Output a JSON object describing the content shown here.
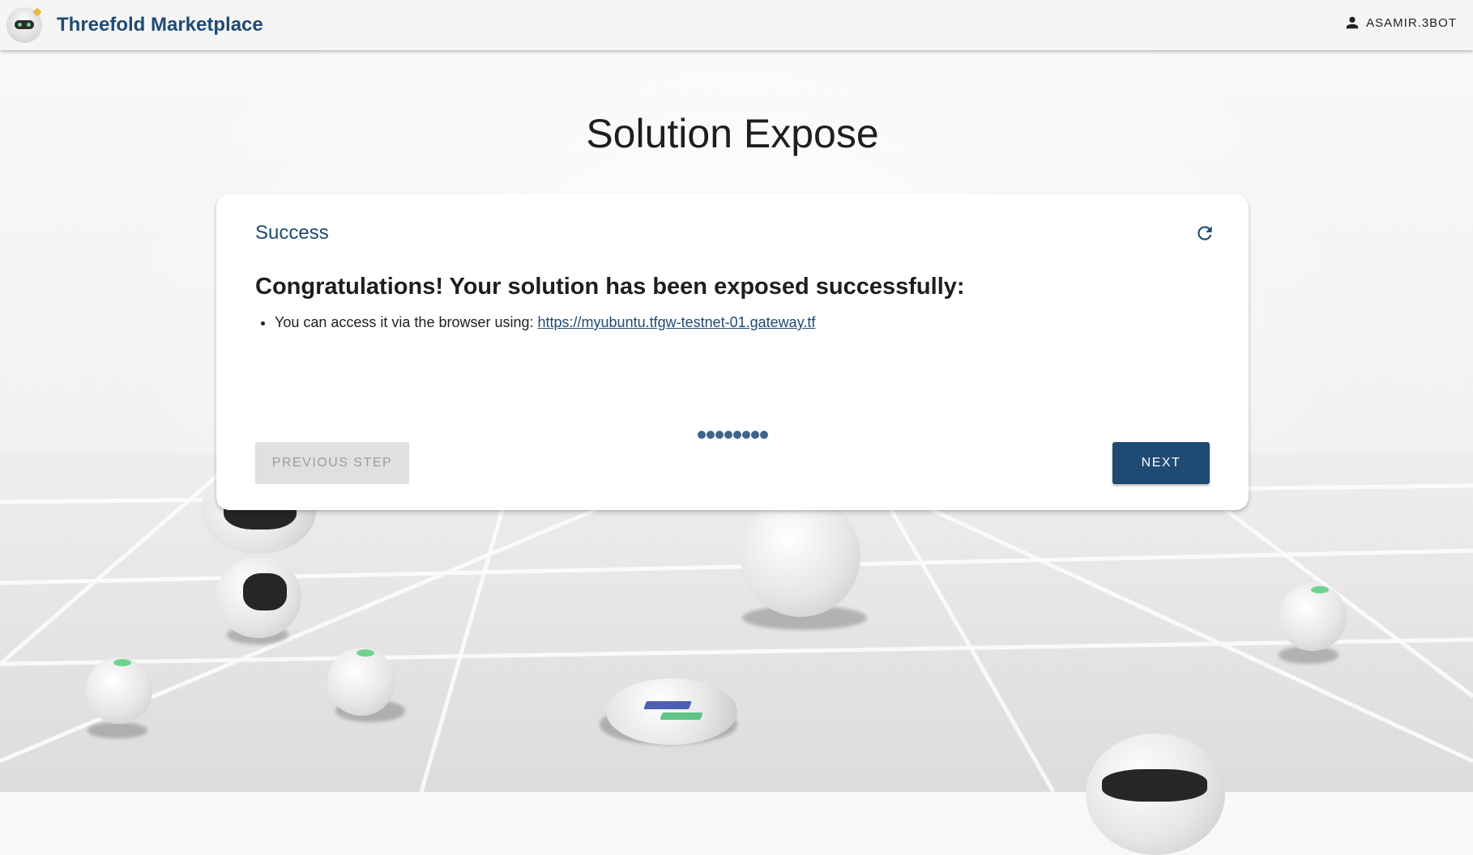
{
  "header": {
    "app_title": "Threefold Marketplace",
    "user_name": "ASAMIR.3BOT"
  },
  "page": {
    "title": "Solution Expose"
  },
  "step": {
    "title": "Success",
    "heading": "Congratulations! Your solution has been exposed successfully:",
    "access_text": "You can access it via the browser using: ",
    "access_link": "https://myubuntu.tfgw-testnet-01.gateway.tf"
  },
  "progress": {
    "total_steps": 8
  },
  "buttons": {
    "previous": "PREVIOUS STEP",
    "next": "NEXT"
  },
  "icons": {
    "user": "person-icon",
    "refresh": "refresh-icon",
    "logo": "3bot-robot-logo"
  },
  "colors": {
    "brand": "#1f4a73",
    "disabled_bg": "#e0e0e0",
    "disabled_text": "#9c9c9c"
  }
}
